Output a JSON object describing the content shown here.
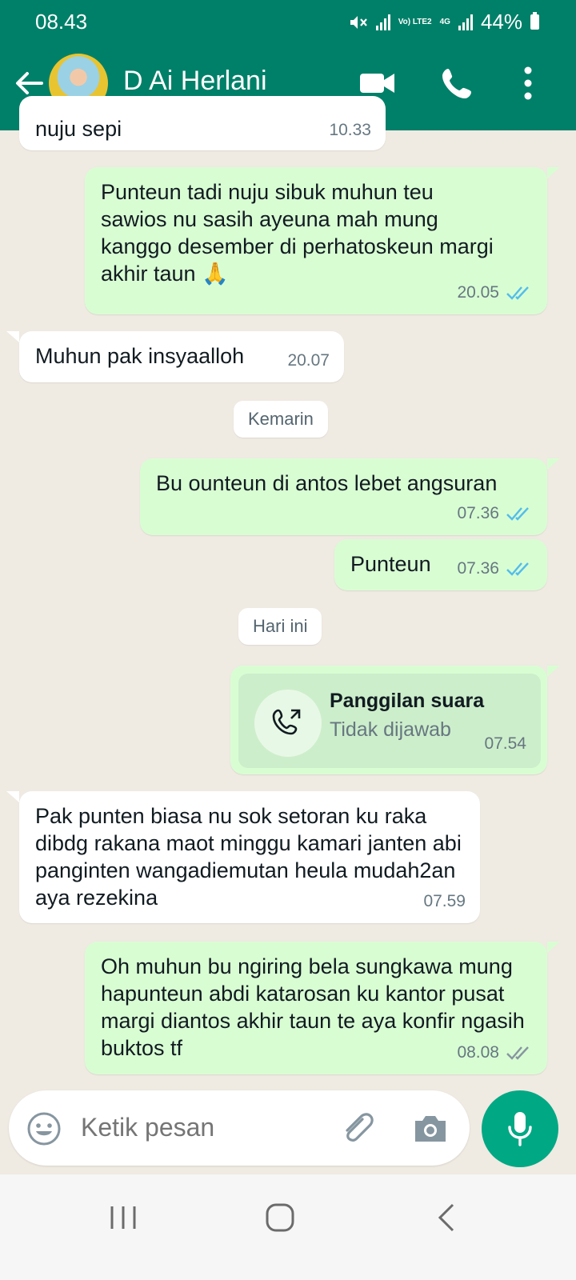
{
  "status_bar": {
    "time": "08.43",
    "network_label": "Vo) LTE2",
    "network_type": "4G",
    "battery": "44%"
  },
  "header": {
    "contact_name": "D Ai Herlani",
    "accent_color": "#008069"
  },
  "messages": [
    {
      "id": "m0",
      "direction": "in",
      "text": "nuju sepi",
      "time": "10.33"
    },
    {
      "id": "m1",
      "direction": "out",
      "text": "Punteun  tadi  nuju sibuk  muhun teu sawios nu sasih ayeuna mah mung kanggo desember di perhatoskeun margi akhir taun 🙏",
      "time": "20.05",
      "status": "read"
    },
    {
      "id": "m2",
      "direction": "in",
      "text": "Muhun pak insyaalloh",
      "time": "20.07"
    },
    {
      "id": "m3",
      "direction": "out",
      "text": "Bu ounteun di antos lebet angsuran",
      "time": "07.36",
      "status": "read"
    },
    {
      "id": "m4",
      "direction": "out",
      "text": "Punteun",
      "time": "07.36",
      "status": "read"
    },
    {
      "id": "m5",
      "direction": "out",
      "type": "call",
      "title": "Panggilan suara",
      "status_text": "Tidak dijawab",
      "time": "07.54"
    },
    {
      "id": "m6",
      "direction": "in",
      "text": "Pak punten biasa nu sok setoran ku raka dibdg rakana maot minggu kamari janten abi panginten wangadiemutan heula mudah2an aya rezekina",
      "time": "07.59"
    },
    {
      "id": "m7",
      "direction": "out",
      "text": "Oh muhun bu ngiring bela sungkawa mung hapunteun abdi katarosan ku kantor pusat margi diantos akhir taun te aya konfir ngasih  buktos tf",
      "time": "08.08",
      "status": "delivered"
    }
  ],
  "date_separators": {
    "yesterday": "Kemarin",
    "today": "Hari ini"
  },
  "input": {
    "placeholder": "Ketik pesan"
  },
  "icons": {
    "back": "arrow-left-icon",
    "video": "video-camera-icon",
    "call": "phone-icon",
    "menu": "more-vert-icon",
    "emoji": "emoji-icon",
    "attach": "paperclip-icon",
    "camera": "camera-icon",
    "mic": "microphone-icon"
  },
  "colors": {
    "outgoing_bubble": "#d9fdd3",
    "incoming_bubble": "#ffffff",
    "read_ticks": "#53bdeb",
    "mic_button": "#00a884"
  }
}
